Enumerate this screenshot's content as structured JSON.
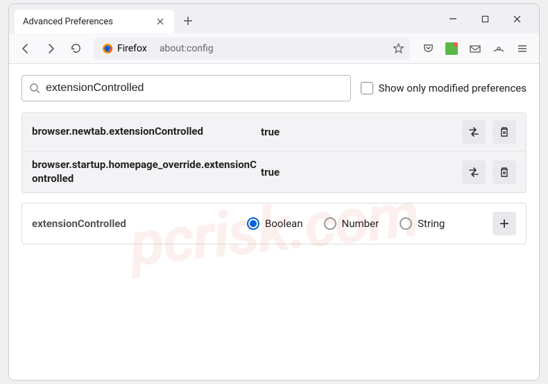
{
  "tab": {
    "title": "Advanced Preferences"
  },
  "urlbar": {
    "identity": "Firefox",
    "url": "about:config"
  },
  "search": {
    "value": "extensionControlled",
    "checkbox_label": "Show only modified preferences"
  },
  "prefs": [
    {
      "name": "browser.newtab.extensionControlled",
      "value": "true"
    },
    {
      "name": "browser.startup.homepage_override.extensionControlled",
      "value": "true"
    }
  ],
  "newpref": {
    "name": "extensionControlled",
    "types": [
      "Boolean",
      "Number",
      "String"
    ],
    "selected": 0
  },
  "watermark": "pcrisk.com"
}
